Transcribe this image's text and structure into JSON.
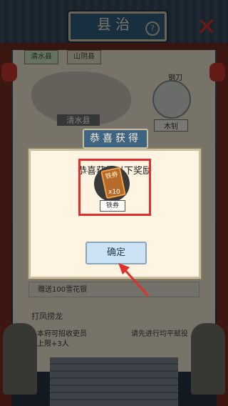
{
  "header": {
    "title": "县治",
    "help_icon": "help-icon",
    "close_icon": "close-icon"
  },
  "tabs": [
    {
      "label": "清水县",
      "active": true
    },
    {
      "label": "山阴县",
      "active": false
    }
  ],
  "map": {
    "label": "清水县"
  },
  "weapon": {
    "label": "钢刀",
    "name": "木钊"
  },
  "gift_text": "赠送100雪花银",
  "section": {
    "title": "打凤捞龙",
    "stat1": "本府可招收吏员",
    "stat2": "上限+3人",
    "hint": "请先进行均平赋役"
  },
  "popup": {
    "ribbon": "恭喜获得",
    "title": "恭喜获得以下奖励",
    "item_name": "铁券",
    "item_count": "x10",
    "ticket_label": "铁券",
    "confirm": "确定"
  },
  "colors": {
    "highlight": "#e0302b",
    "accent": "#3e6481",
    "close": "#d8322d"
  }
}
